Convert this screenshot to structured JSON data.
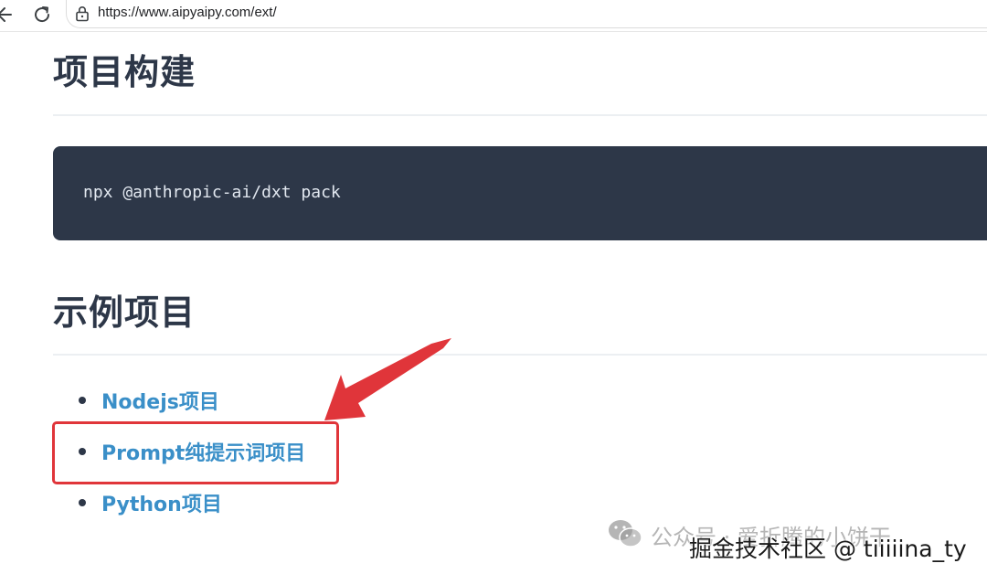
{
  "browser": {
    "url": "https://www.aipyaipy.com/ext/",
    "back_icon": "back-arrow-icon",
    "reload_icon": "reload-icon",
    "lock_icon": "lock-icon"
  },
  "sections": {
    "build_heading": "项目构建",
    "build_command": "npx @anthropic-ai/dxt pack",
    "examples_heading": "示例项目"
  },
  "projects": [
    {
      "label": "Nodejs项目"
    },
    {
      "label": "Prompt纯提示词项目"
    },
    {
      "label": "Python项目"
    }
  ],
  "annotation": {
    "highlight_color": "#e0353a"
  },
  "watermark": {
    "source_text": "公众号 · 爱折腾的小饼干",
    "platform_text": "掘金技术社区 @ tiiiiina_ty",
    "icon": "wechat-icon"
  },
  "colors": {
    "heading": "#2d3748",
    "link": "#3a8fc8",
    "code_bg": "#2d3748",
    "code_text": "#e2e8f0"
  }
}
